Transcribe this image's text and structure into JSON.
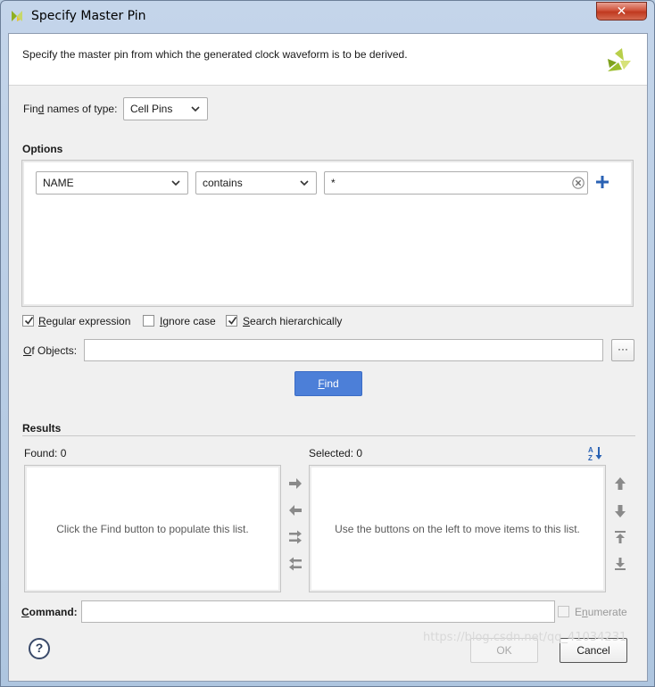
{
  "window": {
    "title": "Specify Master Pin",
    "close_label": "✕"
  },
  "header": {
    "description": "Specify the master pin from which the generated clock waveform is to be derived."
  },
  "find_type": {
    "label_prefix": "Fin",
    "label_accel": "d",
    "label_suffix": " names of type:",
    "value": "Cell Pins"
  },
  "options": {
    "heading": "Options",
    "property": "NAME",
    "operator": "contains",
    "pattern": "*"
  },
  "flags": [
    {
      "accel": "R",
      "rest": "egular expression",
      "checked": true
    },
    {
      "accel": "I",
      "rest": "gnore case",
      "checked": false
    },
    {
      "accel": "S",
      "rest": "earch hierarchically",
      "checked": true
    }
  ],
  "of_objects": {
    "accel": "O",
    "rest": "f Objects:",
    "value": "",
    "browse_label": "···"
  },
  "find_button": {
    "accel": "F",
    "rest": "ind"
  },
  "results": {
    "heading": "Results",
    "found_label": "Found: 0",
    "selected_label": "Selected: 0",
    "found_empty": "Click the Find button to populate this list.",
    "selected_empty": "Use the buttons on the left to move items to this list."
  },
  "command": {
    "accel": "C",
    "rest": "ommand:",
    "value": "",
    "enumerate_accel": "n",
    "enumerate_prefix": "E",
    "enumerate_suffix": "umerate"
  },
  "footer": {
    "help_label": "?",
    "ok_label": "OK",
    "cancel_label": "Cancel"
  },
  "watermark": "https://blog.csdn.net/qq_41034231",
  "colors": {
    "accent": "#4c7fd8",
    "plus": "#2a62b4",
    "logo_green": "#9bbd2c",
    "close_red": "#c0391f"
  }
}
